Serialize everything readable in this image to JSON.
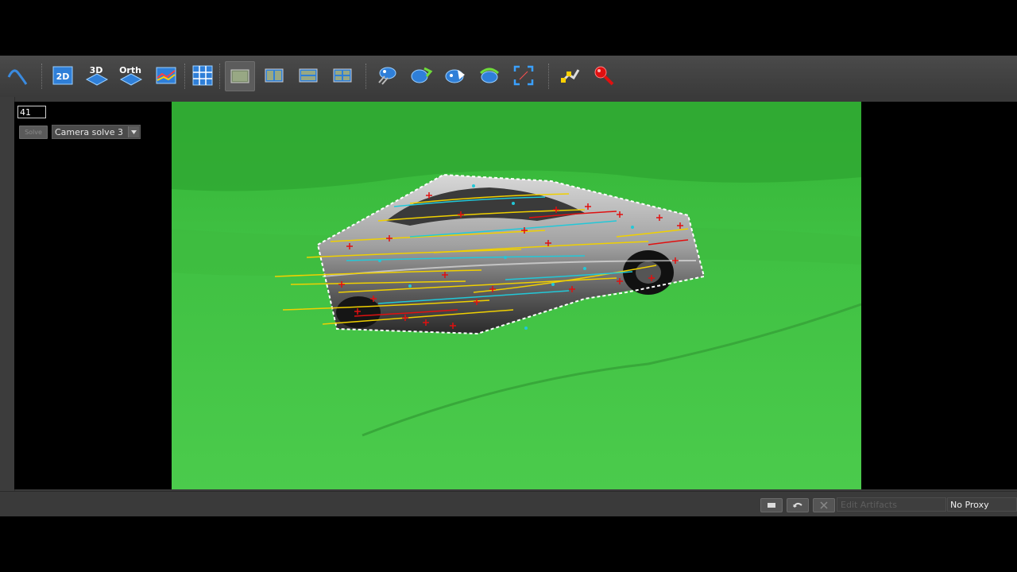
{
  "toolbar": {
    "labels": {
      "view_2d": "2D",
      "view_3d": "3D",
      "view_orth": "Orth"
    }
  },
  "panel": {
    "frame_number": "41",
    "solve_button": "Solve",
    "solve_selector": "Camera solve 3"
  },
  "statusbar": {
    "edit_placeholder": "Edit Artifacts",
    "proxy_label": "No Proxy"
  },
  "colors": {
    "screen_green": "#49c94a",
    "toolbar_bg": "#3f3f3f",
    "tracker_yellow": "#f0d000",
    "tracker_cyan": "#22c8d8",
    "tracker_red": "#e01010"
  }
}
